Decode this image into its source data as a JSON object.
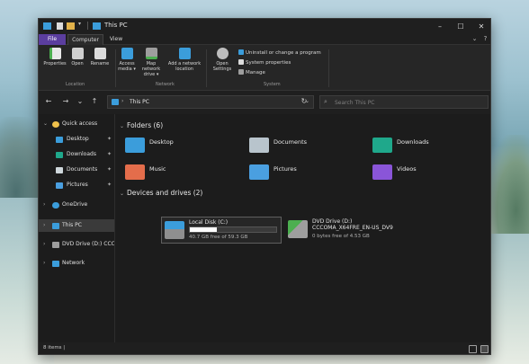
{
  "window": {
    "title": "This PC",
    "controls": {
      "minimize": "–",
      "maximize": "☐",
      "close": "✕"
    }
  },
  "tabs": {
    "file": "File",
    "computer": "Computer",
    "view": "View",
    "collapse": "⌄",
    "help": "?"
  },
  "ribbon": {
    "properties": "Properties",
    "open": "Open",
    "rename": "Rename",
    "access_media": "Access media ▾",
    "map_network_drive": "Map network drive ▾",
    "add_network_location": "Add a network location",
    "open_settings": "Open Settings",
    "uninstall": "Uninstall or change a program",
    "system_properties": "System properties",
    "manage": "Manage",
    "groups": {
      "location": "Location",
      "network": "Network",
      "system": "System"
    }
  },
  "nav": {
    "back": "←",
    "forward": "→",
    "recent": "⌄",
    "up": "↑",
    "address_sep": "›",
    "address": "This PC",
    "address_dropdown": "⌄",
    "refresh": "↻",
    "search_icon": "⌕",
    "search_placeholder": "Search This PC"
  },
  "sidebar": {
    "quick_access": "Quick access",
    "desktop": "Desktop",
    "downloads": "Downloads",
    "documents": "Documents",
    "pictures": "Pictures",
    "onedrive": "OneDrive",
    "this_pc": "This PC",
    "dvd": "DVD Drive (D:) CCCC",
    "network": "Network",
    "chev_open": "⌄",
    "chev_closed": "›",
    "pin": "✦"
  },
  "content": {
    "folders_heading": "Folders (6)",
    "folders": {
      "desktop": "Desktop",
      "documents": "Documents",
      "downloads": "Downloads",
      "music": "Music",
      "pictures": "Pictures",
      "videos": "Videos"
    },
    "devices_heading": "Devices and drives (2)",
    "local_disk": {
      "name": "Local Disk (C:)",
      "free_text": "40.7 GB free of 59.3 GB",
      "used_fraction": 0.31
    },
    "dvd_drive": {
      "name": "DVD Drive (D:)",
      "label": "CCCOMA_X64FRE_EN-US_DV9",
      "free_text": "0 bytes free of 4.53 GB"
    },
    "chev": "⌄"
  },
  "status": {
    "items": "8 items",
    "sep": "|"
  },
  "colors": {
    "accent": "#5b3e9f",
    "folder_blue": "#3b9ddb",
    "folder_yellow": "#e2b24a",
    "folder_green": "#1fa88b",
    "music_orange": "#e46d4b",
    "pictures_blue": "#4a9fe0",
    "videos_purple": "#8a55d8"
  }
}
